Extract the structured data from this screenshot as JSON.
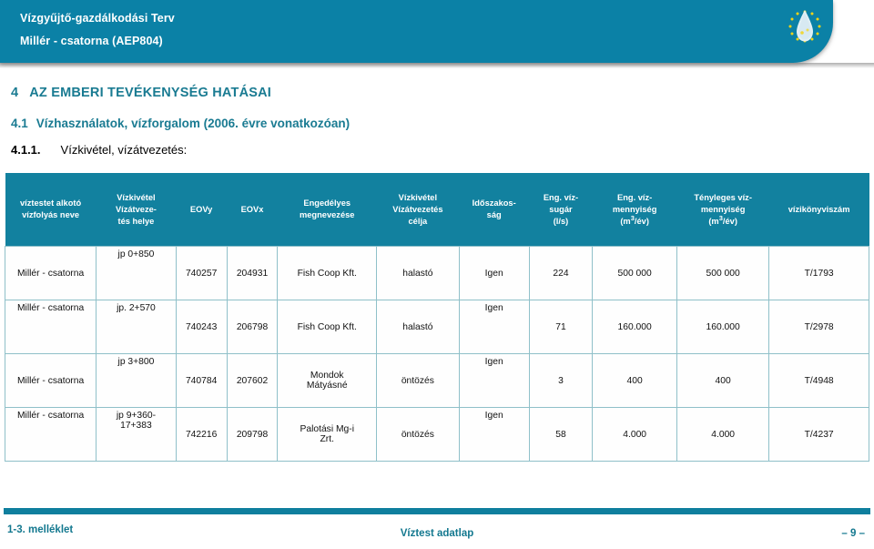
{
  "banner": {
    "title_line1": "Vízgyűjtő-gazdálkodási Terv",
    "title_line2": "Millér - csatorna (AEP804)",
    "logo_icon": "water-droplet-eu-stars-logo",
    "background_color": "#0b81a6"
  },
  "headings": {
    "section_number": "4",
    "section_title": "AZ EMBERI TEVÉKENYSÉG HATÁSAI",
    "subsection_number": "4.1",
    "subsection_title": "Vízhasználatok, vízforgalom (2006. évre vonatkozóan)",
    "subsubsection_number": "4.1.1.",
    "subsubsection_title": "Vízkivétel, vízátvezetés:",
    "heading_color": "#1a7b92"
  },
  "table": {
    "header_bg": "#12819f",
    "border_color": "#8fc0c9",
    "columns": [
      {
        "key": "name",
        "label_lines": [
          "víztestet alkotó",
          "vízfolyás neve"
        ]
      },
      {
        "key": "place",
        "label_lines": [
          "Vízkivétel",
          "Vízátveze-",
          "tés helye"
        ]
      },
      {
        "key": "eovy",
        "label_lines": [
          "EOVy"
        ]
      },
      {
        "key": "eovx",
        "label_lines": [
          "EOVx"
        ]
      },
      {
        "key": "permittee",
        "label_lines": [
          "Engedélyes",
          "megnevezése"
        ]
      },
      {
        "key": "purpose",
        "label_lines": [
          "Vízkivétel",
          "Vízátvezetés",
          "célja"
        ]
      },
      {
        "key": "seasonal",
        "label_lines": [
          "Időszakos-",
          "ság"
        ]
      },
      {
        "key": "jet",
        "label_lines": [
          "Eng. víz-",
          "sugár",
          "(l/s)"
        ]
      },
      {
        "key": "permitted",
        "label_lines": [
          "Eng. víz-",
          "mennyiség",
          "(m³/év)"
        ]
      },
      {
        "key": "actual",
        "label_lines": [
          "Tényleges víz-",
          "mennyiség",
          "(m³/év)"
        ]
      },
      {
        "key": "regnumber",
        "label_lines": [
          "vízikönyviszám"
        ]
      }
    ],
    "rows": [
      {
        "name": "Millér - csatorna",
        "place": "jp 0+850",
        "eovy": "740257",
        "eovx": "204931",
        "permittee": "Fish Coop Kft.",
        "purpose": "halastó",
        "seasonal": "Igen",
        "jet": "224",
        "permitted": "500 000",
        "actual": "500 000",
        "regnumber": "T/1793"
      },
      {
        "name": "Millér - csatorna",
        "place": "jp. 2+570",
        "eovy": "740243",
        "eovx": "206798",
        "permittee": "Fish Coop Kft.",
        "purpose": "halastó",
        "seasonal": "Igen",
        "jet": "71",
        "permitted": "160.000",
        "actual": "160.000",
        "regnumber": "T/2978"
      },
      {
        "name": "Millér - csatorna",
        "place": "jp 3+800",
        "eovy": "740784",
        "eovx": "207602",
        "permittee": "Mondok Mátyásné",
        "purpose": "öntözés",
        "seasonal": "Igen",
        "jet": "3",
        "permitted": "400",
        "actual": "400",
        "regnumber": "T/4948"
      },
      {
        "name": "Millér - csatorna",
        "place": "jp 9+360-17+383",
        "eovy": "742216",
        "eovx": "209798",
        "permittee": "Palotási Mg-i Zrt.",
        "purpose": "öntözés",
        "seasonal": "Igen",
        "jet": "58",
        "permitted": "4.000",
        "actual": "4.000",
        "regnumber": "T/4237"
      }
    ]
  },
  "footer": {
    "left_label": "1-3. melléklet",
    "center_label": "Víztest adatlap",
    "page_label": "– 9 –",
    "rule_color": "#0f7f9e",
    "text_color": "#13788f"
  }
}
